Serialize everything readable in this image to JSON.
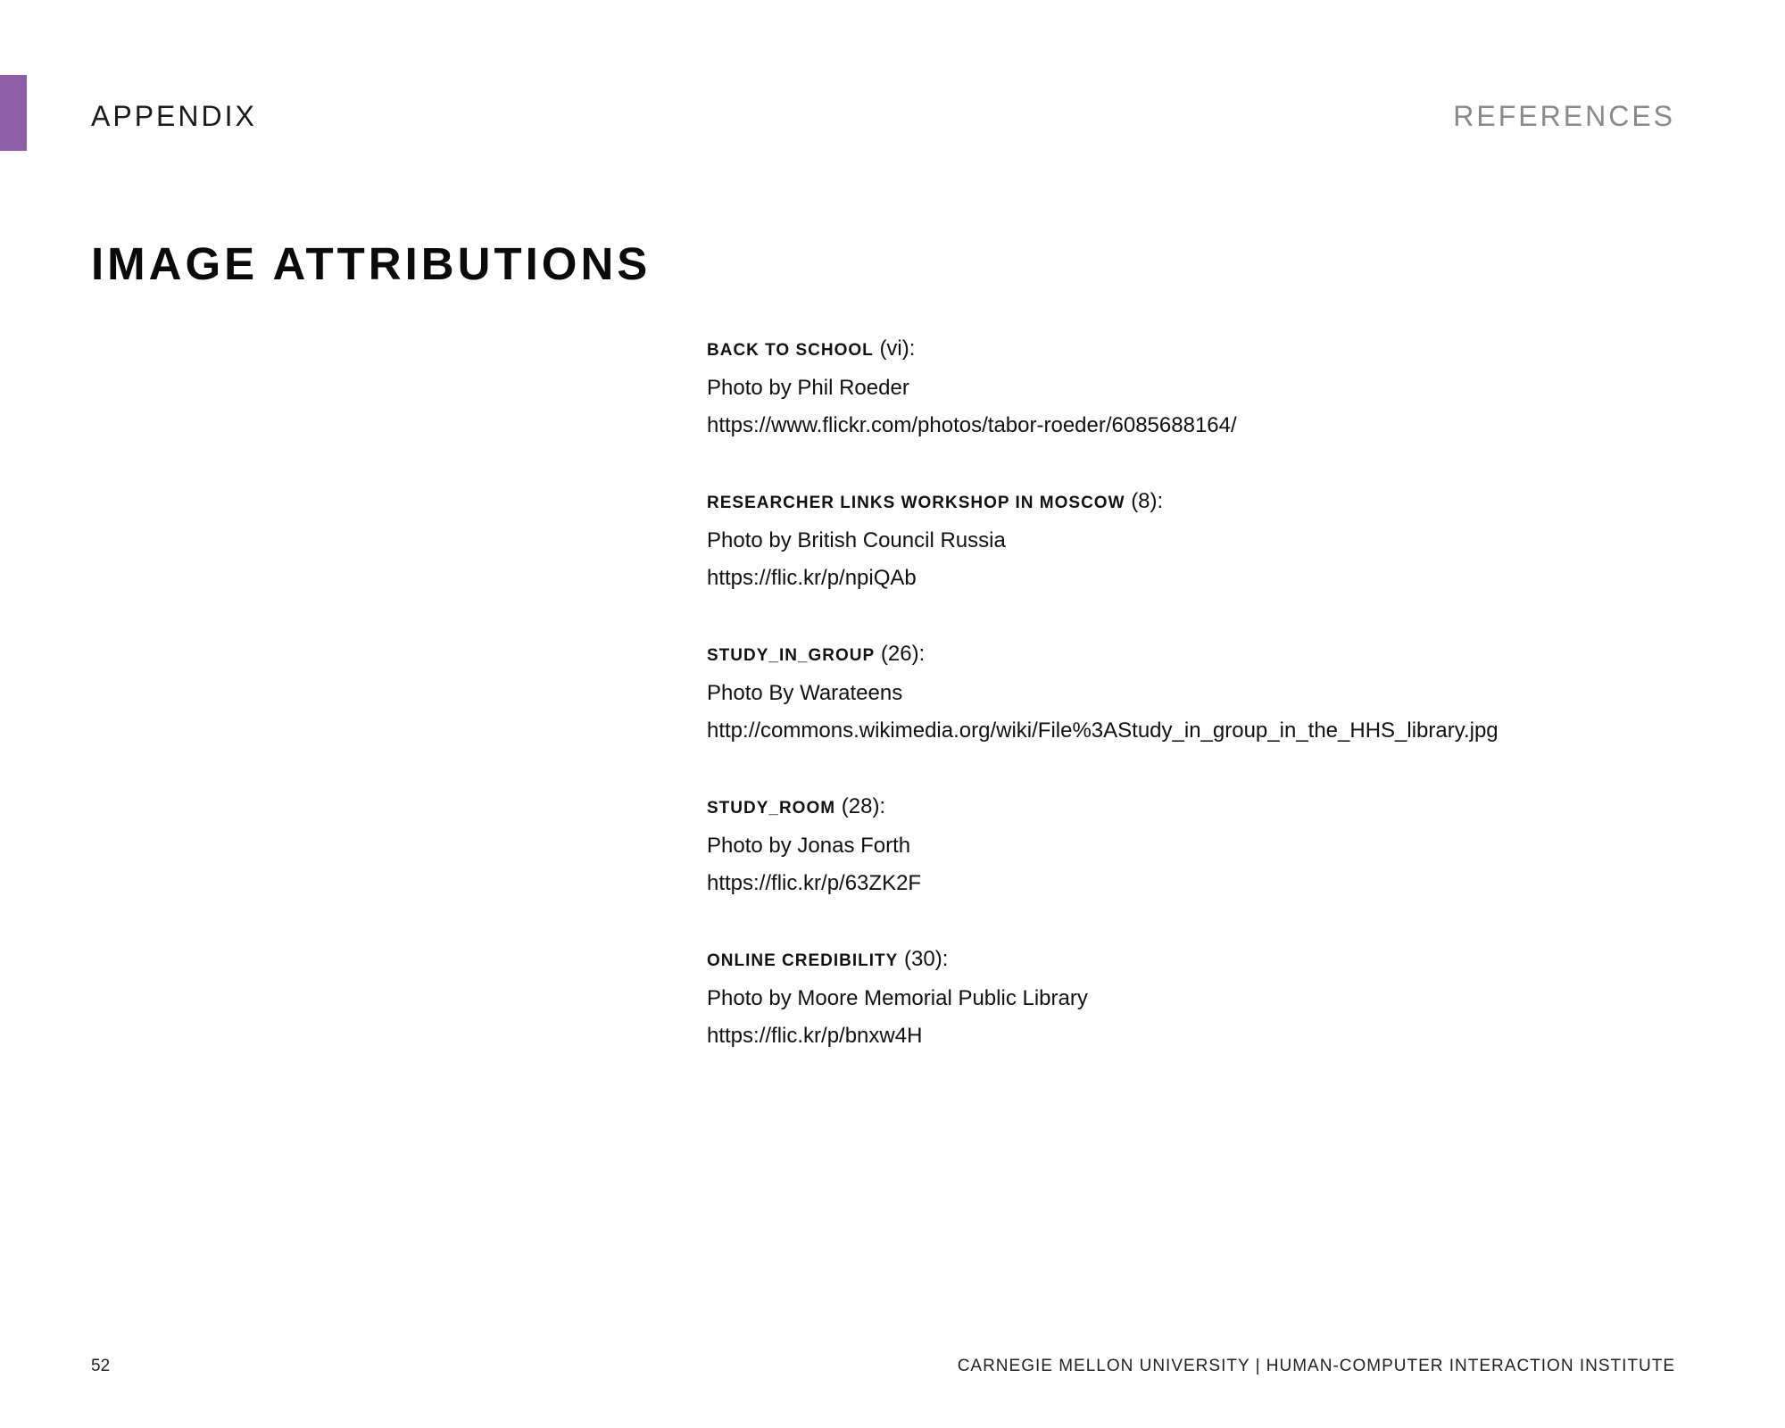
{
  "colors": {
    "accent": "#8e5ea8",
    "header_right": "#8a8a8a"
  },
  "header": {
    "section": "APPENDIX",
    "right": "REFERENCES"
  },
  "title": "IMAGE ATTRIBUTIONS",
  "entries": [
    {
      "title": "BACK TO SCHOOL",
      "page": "(vi):",
      "credit": "Photo by Phil Roeder",
      "url": "https://www.flickr.com/photos/tabor-roeder/6085688164/"
    },
    {
      "title": "RESEARCHER LINKS WORKSHOP IN MOSCOW",
      "page": "(8):",
      "credit": "Photo by British Council Russia",
      "url": "https://flic.kr/p/npiQAb"
    },
    {
      "title": "STUDY_IN_GROUP",
      "page": "(26):",
      "credit": "Photo By Warateens",
      "url": "http://commons.wikimedia.org/wiki/File%3AStudy_in_group_in_the_HHS_library.jpg"
    },
    {
      "title": "STUDY_ROOM",
      "page": "(28):",
      "credit": "Photo by Jonas Forth",
      "url": "https://flic.kr/p/63ZK2F"
    },
    {
      "title": "ONLINE CREDIBILITY",
      "page": "(30):",
      "credit": "Photo by Moore Memorial Public Library",
      "url": "https://flic.kr/p/bnxw4H"
    }
  ],
  "footer": {
    "page_number": "52",
    "text": "CARNEGIE MELLON UNIVERSITY | HUMAN-COMPUTER INTERACTION INSTITUTE"
  }
}
